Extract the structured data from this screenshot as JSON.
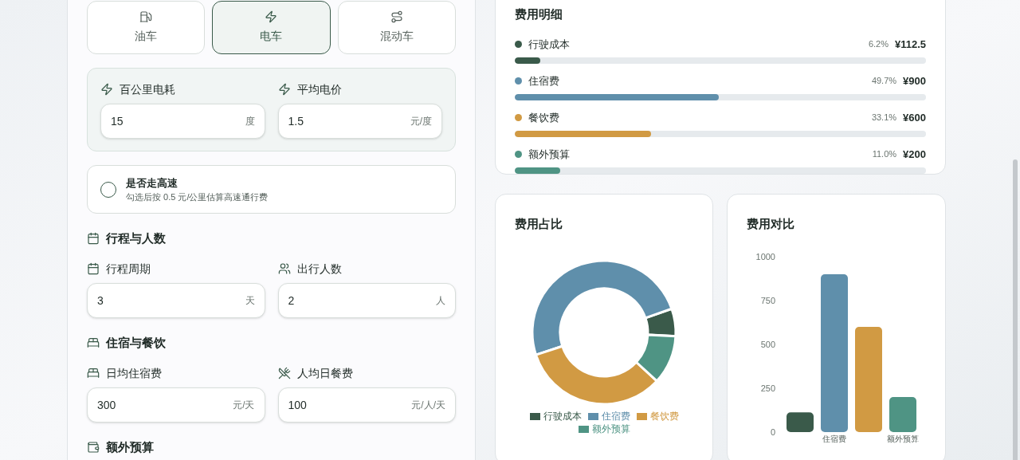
{
  "vehicle_tabs": [
    {
      "label": "油车",
      "selected": false
    },
    {
      "label": "电车",
      "selected": true
    },
    {
      "label": "混动车",
      "selected": false
    }
  ],
  "energy_fields": [
    {
      "label": "百公里电耗",
      "value": "15",
      "unit": "度"
    },
    {
      "label": "平均电价",
      "value": "1.5",
      "unit": "元/度"
    }
  ],
  "highway": {
    "title": "是否走高速",
    "hint": "勾选后按 0.5 元/公里估算高速通行费",
    "checked": false
  },
  "sections": [
    {
      "title": "行程与人数",
      "fields": [
        {
          "label": "行程周期",
          "value": "3",
          "unit": "天"
        },
        {
          "label": "出行人数",
          "value": "2",
          "unit": "人"
        }
      ]
    },
    {
      "title": "住宿与餐饮",
      "fields": [
        {
          "label": "日均住宿费",
          "value": "300",
          "unit": "元/天"
        },
        {
          "label": "人均日餐费",
          "value": "100",
          "unit": "元/人/天"
        }
      ]
    },
    {
      "title": "额外预算"
    }
  ],
  "detail": {
    "title": "费用明细",
    "items": [
      {
        "name": "行驶成本",
        "color": "#3a5a4a",
        "percent": "6.2%",
        "amount": "¥112.5",
        "level": 0.062
      },
      {
        "name": "住宿费",
        "color": "#5f8fab",
        "percent": "49.7%",
        "amount": "¥900",
        "level": 0.497
      },
      {
        "name": "餐饮费",
        "color": "#d19a43",
        "percent": "33.1%",
        "amount": "¥600",
        "level": 0.331
      },
      {
        "name": "额外预算",
        "color": "#4f9484",
        "percent": "11.0%",
        "amount": "¥200",
        "level": 0.11
      }
    ]
  },
  "share_chart": {
    "title": "费用占比",
    "chart_data": {
      "type": "donut",
      "categories": [
        "行驶成本",
        "住宿费",
        "餐饮费",
        "额外预算"
      ],
      "values": [
        6.2,
        49.7,
        33.1,
        11.0
      ],
      "colors": [
        "#3a5a4a",
        "#5f8fab",
        "#d19a43",
        "#4f9484"
      ],
      "legend": "bottom"
    }
  },
  "compare_chart": {
    "title": "费用对比",
    "chart_data": {
      "type": "bar",
      "categories": [
        null,
        "住宿费",
        null,
        "额外预算"
      ],
      "values": [
        112.5,
        900,
        600,
        200
      ],
      "colors": [
        "#3a5a4a",
        "#5f8fab",
        "#d19a43",
        "#4f9484"
      ],
      "ylim": [
        0,
        1000
      ],
      "yticks": [
        0,
        250,
        500,
        750,
        1000
      ]
    }
  }
}
